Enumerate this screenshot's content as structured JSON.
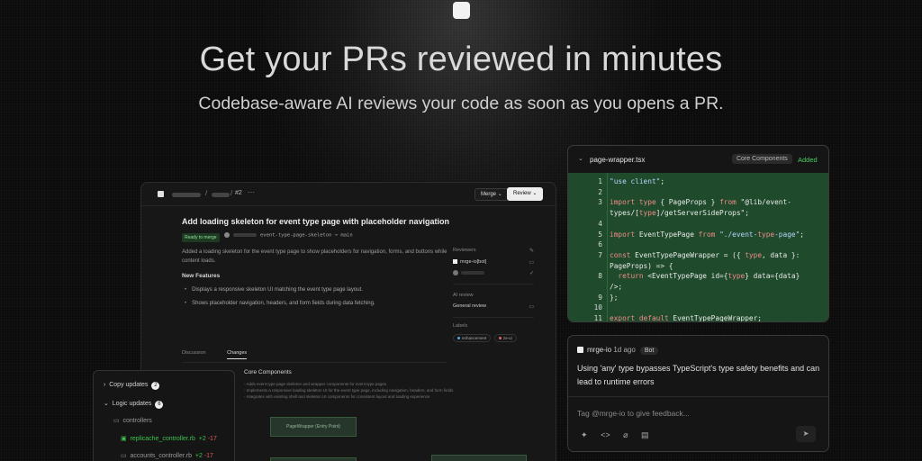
{
  "hero": {
    "title": "Get your PRs reviewed in minutes",
    "subtitle": "Codebase-aware AI reviews your code as soon as you opens a PR."
  },
  "pr": {
    "number": "#2",
    "merge_label": "Merge",
    "review_label": "Review",
    "title": "Add loading skeleton for event type page with placeholder navigation",
    "status": "Ready to merge",
    "branch": "event-type-page-skeleton → main",
    "description": "Added a loading skeleton for the event type page to show placeholders for navigation, forms, and buttons while content loads.",
    "new_features_heading": "New Features",
    "features": [
      "Displays a responsive skeleton UI matching the event type page layout.",
      "Shows placeholder navigation, headers, and form fields during data fetching."
    ],
    "sidebar": {
      "reviewers_label": "Reviewers",
      "reviewer": "mrge-io[bot]",
      "ai_review_label": "AI review",
      "ai_review_value": "General review",
      "labels_label": "Labels",
      "labels": [
        {
          "name": "enhancement",
          "color": "#4fb0e0"
        },
        {
          "name": "ze-ui",
          "color": "#e06666"
        }
      ]
    },
    "tabs": [
      "Discussion",
      "Changes"
    ],
    "core_heading": "Core Components",
    "core_items": [
      "Adds event type page skeleton and wrapper components for event type pages",
      "Implements a responsive loading skeleton UI for the event type page, including navigation, headers, and form fields",
      "Integrates with existing shell and skeleton UI components for consistent layout and loading experience"
    ],
    "flow_box_label": "PageWrapper (Entry Point)"
  },
  "tree": {
    "items": [
      {
        "label": "Copy updates",
        "count": "2"
      },
      {
        "label": "Logic updates",
        "count": "6"
      },
      {
        "label": "controllers"
      },
      {
        "label": "replicache_controller.rb",
        "add": "+2",
        "del": "-17"
      },
      {
        "label": "accounts_controller.rb",
        "add": "+2",
        "del": "-17"
      }
    ]
  },
  "code": {
    "filename": "page-wrapper.tsx",
    "tag": "Core Components",
    "status": "Added",
    "lines": [
      {
        "n": "1",
        "t": "\"use client\";"
      },
      {
        "n": "2",
        "t": ""
      },
      {
        "n": "3",
        "t": "import type { PageProps } from \"@lib/event-"
      },
      {
        "n": "",
        "t": "types/[type]/getServerSideProps\";"
      },
      {
        "n": "4",
        "t": ""
      },
      {
        "n": "5",
        "t": "import EventTypePage from \"./event-type-page\";"
      },
      {
        "n": "6",
        "t": ""
      },
      {
        "n": "7",
        "t": "const EventTypePageWrapper = ({ type, data }:"
      },
      {
        "n": "",
        "t": "PageProps) => {"
      },
      {
        "n": "8",
        "t": "  return <EventTypePage id={type} data={data}"
      },
      {
        "n": "",
        "t": "/>;"
      },
      {
        "n": "9",
        "t": "};"
      },
      {
        "n": "10",
        "t": ""
      },
      {
        "n": "11",
        "t": "export default EventTypePageWrapper;"
      }
    ]
  },
  "comment": {
    "author": "mrge-io",
    "time": "1d ago",
    "badge": "Bot",
    "body": "Using 'any' type bypasses TypeScript's type safety benefits and can lead to runtime errors",
    "placeholder": "Tag @mrge-io to give feedback..."
  }
}
